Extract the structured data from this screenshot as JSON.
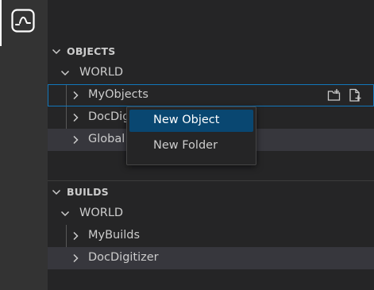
{
  "activity_bar": {
    "items": [
      {
        "icon": "pulse-graph-icon",
        "active": true
      }
    ]
  },
  "sections": {
    "objects": {
      "title": "OBJECTS",
      "root": "WORLD",
      "items": [
        {
          "label": "MyObjects"
        },
        {
          "label": "DocDigi"
        },
        {
          "label": "Global"
        }
      ],
      "row_actions": [
        "new-folder-icon",
        "new-file-icon"
      ]
    },
    "builds": {
      "title": "BUILDS",
      "root": "WORLD",
      "items": [
        {
          "label": "MyBuilds"
        },
        {
          "label": "DocDigitizer"
        }
      ]
    }
  },
  "context_menu": {
    "items": [
      {
        "label": "New Object",
        "selected": true
      },
      {
        "label": "New Folder",
        "selected": false
      }
    ]
  },
  "colors": {
    "activity_bar": "#333333",
    "sidebar": "#252526",
    "selection": "#094771",
    "focus_border": "#1177bb",
    "alt_row": "#37373d"
  }
}
